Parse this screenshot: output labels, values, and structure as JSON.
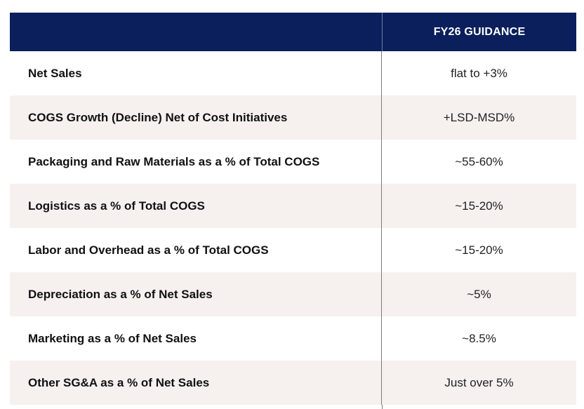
{
  "header": {
    "label": "",
    "value": "FY26 GUIDANCE"
  },
  "rows": [
    {
      "label": "Net Sales",
      "value": "flat to +3%"
    },
    {
      "label": "COGS Growth (Decline) Net of Cost Initiatives",
      "value": "+LSD-MSD%"
    },
    {
      "label": "Packaging and Raw Materials as a % of Total COGS",
      "value": "~55-60%"
    },
    {
      "label": "Logistics as a % of Total COGS",
      "value": "~15-20%"
    },
    {
      "label": "Labor and Overhead as a % of Total COGS",
      "value": "~15-20%"
    },
    {
      "label": "Depreciation as a % of Net Sales",
      "value": "~5%"
    },
    {
      "label": "Marketing as a % of Net Sales",
      "value": "~8.5%"
    },
    {
      "label": "Other SG&A as a % of Net Sales",
      "value": "Just over 5%"
    }
  ],
  "colors": {
    "header_bg": "#0a1f5c",
    "shaded_row": "#f6f1ee"
  }
}
